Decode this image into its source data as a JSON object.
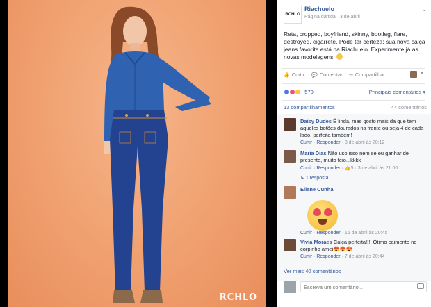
{
  "photo": {
    "watermark": "RCHLO"
  },
  "post": {
    "page_name": "Riachuelo",
    "logo_text": "RCHLO",
    "meta": "Página curtida · 3 de abril",
    "text": "Reta, cropped, boyfriend, skinny, bootleg, flare, destroyed, cigarrete. Pode ter certeza: sua nova calça jeans favorita está na Riachuelo. Experimente já as novas modelagens.",
    "actions": {
      "like": "Curtir",
      "comment": "Comentar",
      "share": "Compartilhar"
    },
    "reactions_count": "570",
    "top_comments": "Principais comentários ▾",
    "shares": "13 compartilhamentos",
    "comments_count": "44 comentários"
  },
  "comments": [
    {
      "name": "Daisy Dudes",
      "text": "É linda, mas gosto mais da que tem aqueles botões dourados na frente ou seja 4 de cada lado, perfeita também!",
      "like": "Curtir",
      "reply": "Responder",
      "time": "3 de abril às 20:12"
    },
    {
      "name": "Maria Dias",
      "text": "Não uso isso nem se eu ganhar de presente, muito feio...kkkk",
      "like": "Curtir",
      "reply": "Responder",
      "reacts": "5",
      "time": "3 de abril às 21:00",
      "replies": "1 resposta"
    },
    {
      "name": "Eliane Cunha",
      "text": "",
      "like": "Curtir",
      "reply": "Responder",
      "time": "16 de abril às 20:45"
    },
    {
      "name": "Vivia Moraes",
      "text": "Calça perfeita!!!! Ótimo caimento no corpinho amei😍😍😍",
      "like": "Curtir",
      "reply": "Responder",
      "time": "7 de abril às 20:44"
    }
  ],
  "more_comments": "Ver mais 40 comentários",
  "write_placeholder": "Escreva um comentário...",
  "colors": {
    "link": "#365899",
    "muted": "#90949c",
    "backdrop": "#f0a06f",
    "denim": "#2c4f9e"
  }
}
